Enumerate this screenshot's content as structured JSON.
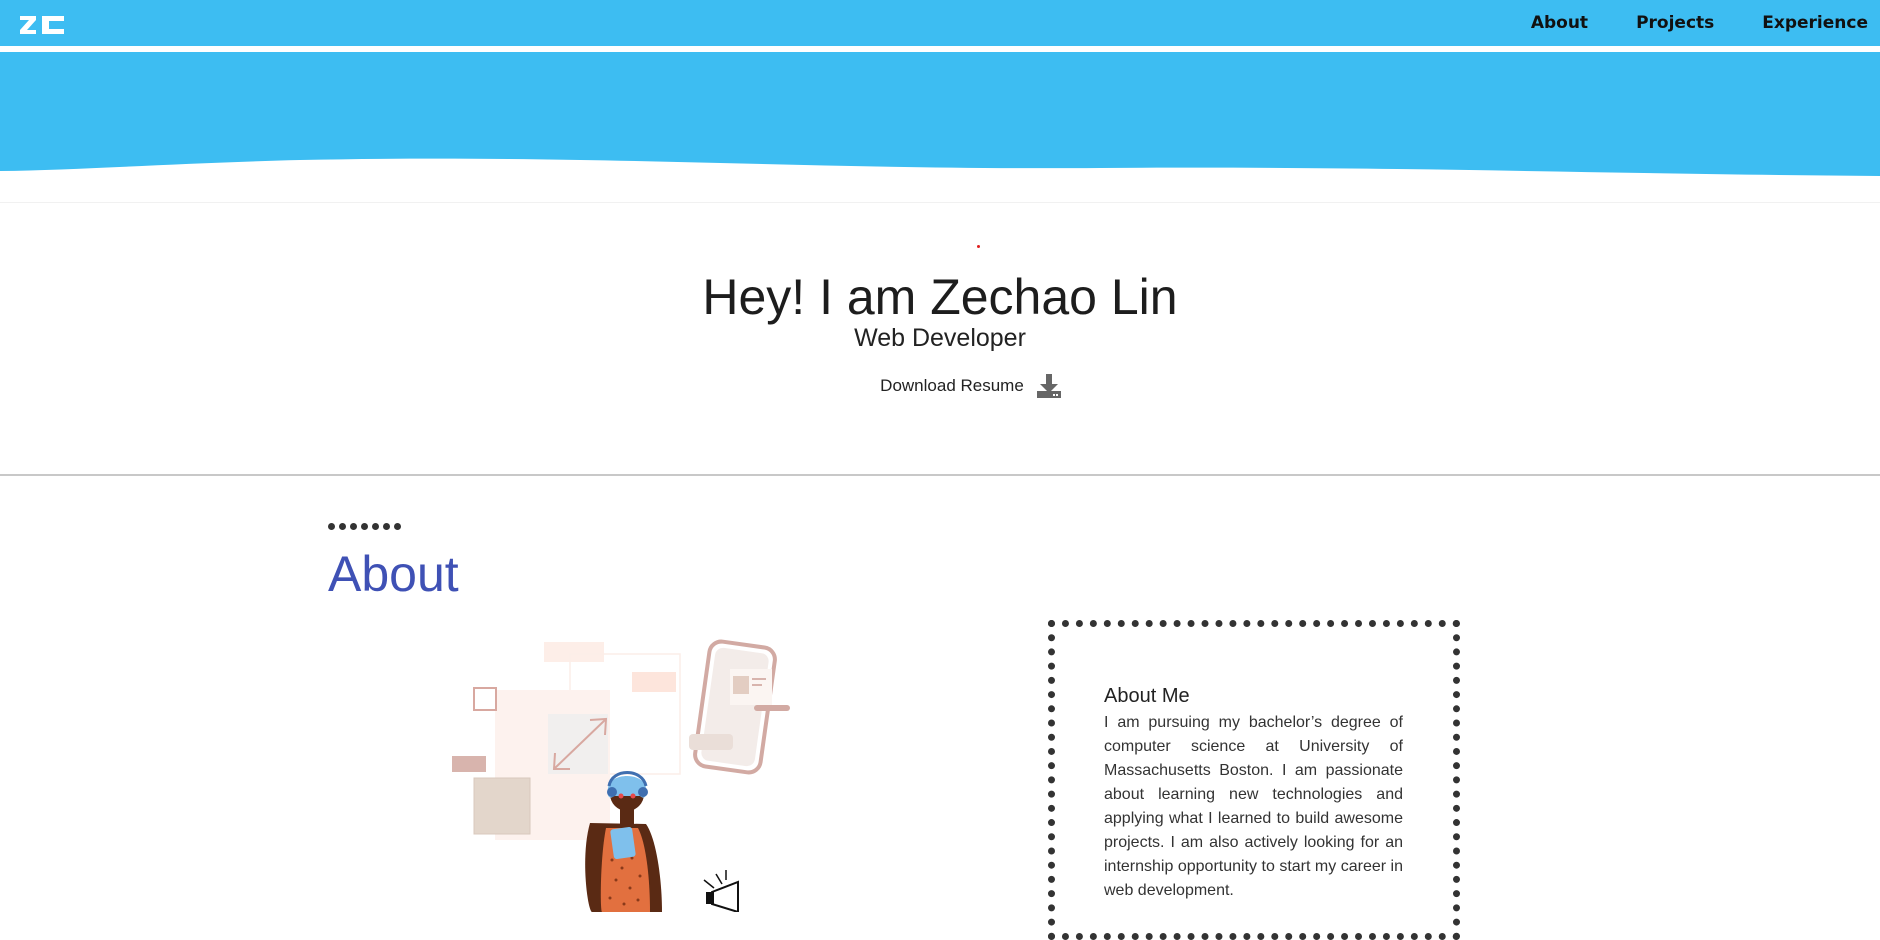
{
  "navbar": {
    "logo_text": "ZC",
    "links": [
      {
        "label": "About"
      },
      {
        "label": "Projects"
      },
      {
        "label": "Experience"
      }
    ]
  },
  "hero": {
    "title": "Hey! I am Zechao Lin",
    "subtitle": "Web Developer",
    "resume_label": "Download Resume",
    "resume_icon": "download-icon"
  },
  "about": {
    "heading": "About",
    "card_title": "About Me",
    "card_text": "I am pursuing my bachelor’s degree of computer science at University of Massachusetts Boston. I am passionate about learning new technologies and applying what I learned to build awesome projects. I am also actively looking for an internship opportunity to start my career in web development."
  },
  "colors": {
    "header_blue": "#3dbdf2",
    "about_heading": "#3f51b5",
    "text_dark": "#222222"
  }
}
